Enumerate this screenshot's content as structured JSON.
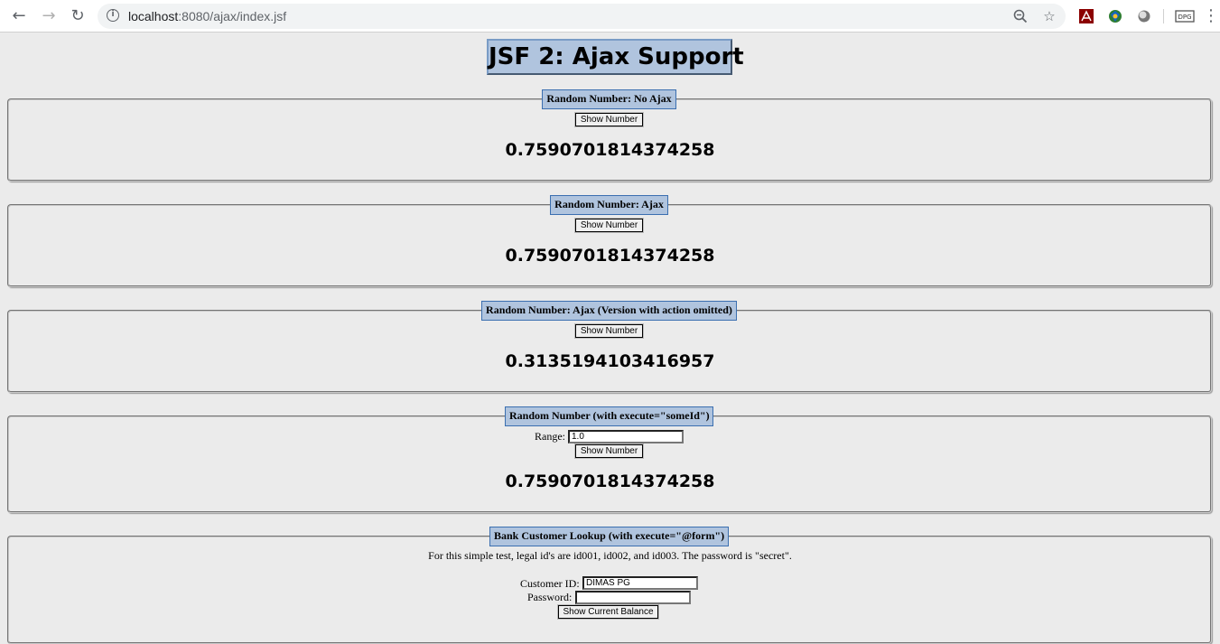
{
  "browser": {
    "url_host": "localhost",
    "url_rest": ":8080/ajax/index.jsf"
  },
  "page": {
    "title": "JSF 2: Ajax Support",
    "sections": [
      {
        "legend": "Random Number: No Ajax",
        "button": "Show Number",
        "result": "0.7590701814374258"
      },
      {
        "legend": "Random Number: Ajax",
        "button": "Show Number",
        "result": "0.7590701814374258"
      },
      {
        "legend": "Random Number: Ajax (Version with action omitted)",
        "button": "Show Number",
        "result": "0.3135194103416957"
      },
      {
        "legend": "Random Number (with execute=\"someId\")",
        "range_label": "Range:",
        "range_value": "1.0",
        "button": "Show Number",
        "result": "0.7590701814374258"
      },
      {
        "legend": "Bank Customer Lookup (with execute=\"@form\")",
        "note": "For this simple test, legal id's are id001, id002, and id003. The password is \"secret\".",
        "customer_id_label": "Customer ID:",
        "customer_id_value": "DIMAS PG",
        "password_label": "Password:",
        "password_value": "",
        "button": "Show Current Balance"
      }
    ]
  }
}
